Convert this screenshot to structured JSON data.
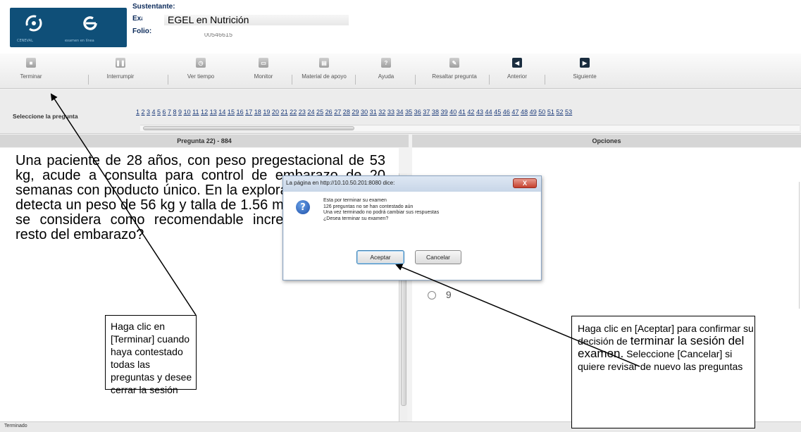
{
  "header": {
    "logo_left_text": "CENEVAL",
    "logo_right_text": "examen en línea",
    "sustentante_label": "Sustentante:",
    "examen_label": "Examen:",
    "examen_value": "EGEL en Nutrición",
    "folio_label": "Folio:",
    "folio_value": "00546615"
  },
  "toolbar": {
    "terminar": "Terminar",
    "interrumpir": "Interrumpir",
    "ver_tiempo": "Ver tiempo",
    "monitor": "Monitor",
    "material": "Material de apoyo",
    "ayuda": "Ayuda",
    "resaltar": "Resaltar pregunta",
    "anterior": "Anterior",
    "siguiente": "Siguiente"
  },
  "selector": {
    "label": "Seleccione la pregunta",
    "numbers": [
      "1",
      "2",
      "3",
      "4",
      "5",
      "6",
      "7",
      "8",
      "9",
      "10",
      "11",
      "12",
      "13",
      "14",
      "15",
      "16",
      "17",
      "18",
      "19",
      "20",
      "21",
      "22",
      "23",
      "24",
      "25",
      "26",
      "27",
      "28",
      "29",
      "30",
      "31",
      "32",
      "33",
      "34",
      "35",
      "36",
      "37",
      "38",
      "39",
      "40",
      "41",
      "42",
      "43",
      "44",
      "45",
      "46",
      "47",
      "48",
      "49",
      "50",
      "51",
      "52",
      "53"
    ]
  },
  "question": {
    "header": "Pregunta 22) - 884",
    "text": "Una paciente de 28 años, con peso pregestacional de 53 kg, acude a consulta para control de embarazo de 20 semanas con producto único. En la exploración física se le detecta un peso de 56 kg y talla de 1.56 m. ¿Cuántos kilos se considera como recomendable incrementar para el resto del embarazo?"
  },
  "options": {
    "header": "Opciones",
    "visible_option": "9"
  },
  "dialog": {
    "title": "La página en http://10.10.50.201:8080 dice:",
    "line1": "Esta por terminar su examen",
    "line2": "126 preguntas no se han contestado aún",
    "line3": "Una vez terminado no podrá cambiar sus respuestas",
    "line4": "¿Desea terminar su examen?",
    "ok": "Aceptar",
    "cancel": "Cancelar",
    "close": "X"
  },
  "callouts": {
    "terminar_help": "Haga clic en [Terminar] cuando haya contestado todas las preguntas y desee cerrar la sesión",
    "aceptar_help_part1": "Haga clic en [Aceptar] para confirmar su decisión de",
    "aceptar_help_big": "terminar la sesión del examen.",
    "aceptar_help_part2": "Seleccione [Cancelar] si quiere revisar de nuevo las preguntas"
  },
  "statusbar": {
    "text": "Terminado"
  },
  "colors": {
    "header_blue": "#0f4f78",
    "link_blue": "#1a3a7a",
    "dialog_close_red": "#c5402e"
  }
}
